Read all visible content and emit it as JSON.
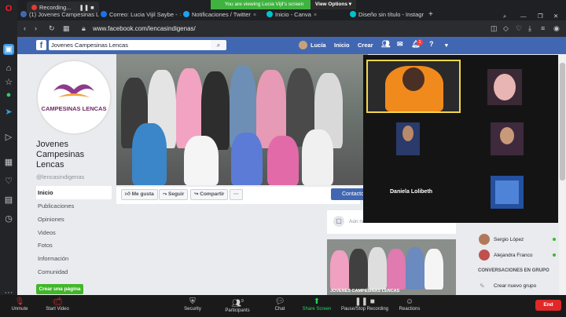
{
  "browser": {
    "recording_label": "Recording...",
    "tabs": [
      {
        "label": "(1) Jovenes Campesinas L",
        "color": "#4267b2"
      },
      {
        "label": "Correo: Lucia Vijil Saybe -",
        "color": "#1a73e8"
      },
      {
        "label": "Notificaciones / Twitter",
        "color": "#1da1f2"
      },
      {
        "label": "Inicio - Canva",
        "color": "#00c4cc"
      },
      {
        "label": "Diseño sin título - Instagr",
        "color": "#00c4cc"
      }
    ],
    "new_tab": "+",
    "url": "www.facebook.com/lencasindigenas/"
  },
  "zoom_banner": {
    "viewing": "You are viewing Lucia Vijil's screen",
    "view_options": "View Options"
  },
  "facebook": {
    "logo": "f",
    "search_value": "Jovenes Campesinas Lencas",
    "user": "Lucía",
    "nav": [
      "Inicio",
      "Crear"
    ],
    "notif_count": "1",
    "page": {
      "profile_text": "CAMPESINAS LENCAS",
      "name": "Jovenes Campesinas Lencas",
      "handle": "@lencasindigenas",
      "menu": [
        "Inicio",
        "Publicaciones",
        "Opiniones",
        "Videos",
        "Fotos",
        "Información",
        "Comunidad"
      ],
      "create_page": "Crear una página"
    },
    "actions": {
      "like": "Me gusta",
      "follow": "Seguir",
      "share": "Compartir",
      "more": "···",
      "contact": "Contacto"
    },
    "post_placeholder": "Aún no...",
    "post_caption": "JOVENES CAMPESINAS LENCAS",
    "right_rail": {
      "contacts": [
        "Sergio López",
        "Alejandra Franco"
      ],
      "group_heading": "CONVERSACIONES EN GRUPO",
      "create_group": "Crear nuevo grupo"
    }
  },
  "video": {
    "participant_name": "Daniela Lolibeth"
  },
  "zoom_toolbar": {
    "unmute": "Unmute",
    "start_video": "Start Video",
    "security": "Security",
    "participants": "Participants",
    "participants_count": "9",
    "chat": "Chat",
    "share_screen": "Share Screen",
    "pause_recording": "Pause/Stop Recording",
    "reactions": "Reactions",
    "end": "End"
  },
  "colors": {
    "fb_blue": "#4267b2",
    "zoom_green": "#3fb33f",
    "end_red": "#e02828",
    "share_green": "#23d959"
  }
}
